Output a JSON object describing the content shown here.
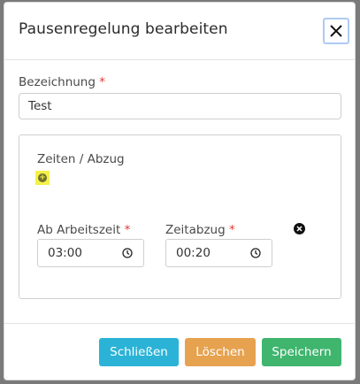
{
  "dialog": {
    "title": "Pausenregelung bearbeiten"
  },
  "bezeichnung": {
    "label": "Bezeichnung",
    "required_mark": "*",
    "value": "Test"
  },
  "zeiten": {
    "title": "Zeiten / Abzug",
    "add_icon": "plus-circle-icon",
    "rows": [
      {
        "ab_label": "Ab Arbeitszeit",
        "ab_value": "03:00",
        "abzug_label": "Zeitabzug",
        "abzug_value": "00:20",
        "required_mark": "*",
        "remove_icon": "x-circle-icon"
      }
    ]
  },
  "footer": {
    "close_label": "Schließen",
    "delete_label": "Löschen",
    "save_label": "Speichern"
  },
  "colors": {
    "close_button": "#2ab3d6",
    "delete_button": "#e6a24f",
    "save_button": "#3fb56e",
    "required": "#e53935",
    "add_highlight": "#f4f14a"
  }
}
